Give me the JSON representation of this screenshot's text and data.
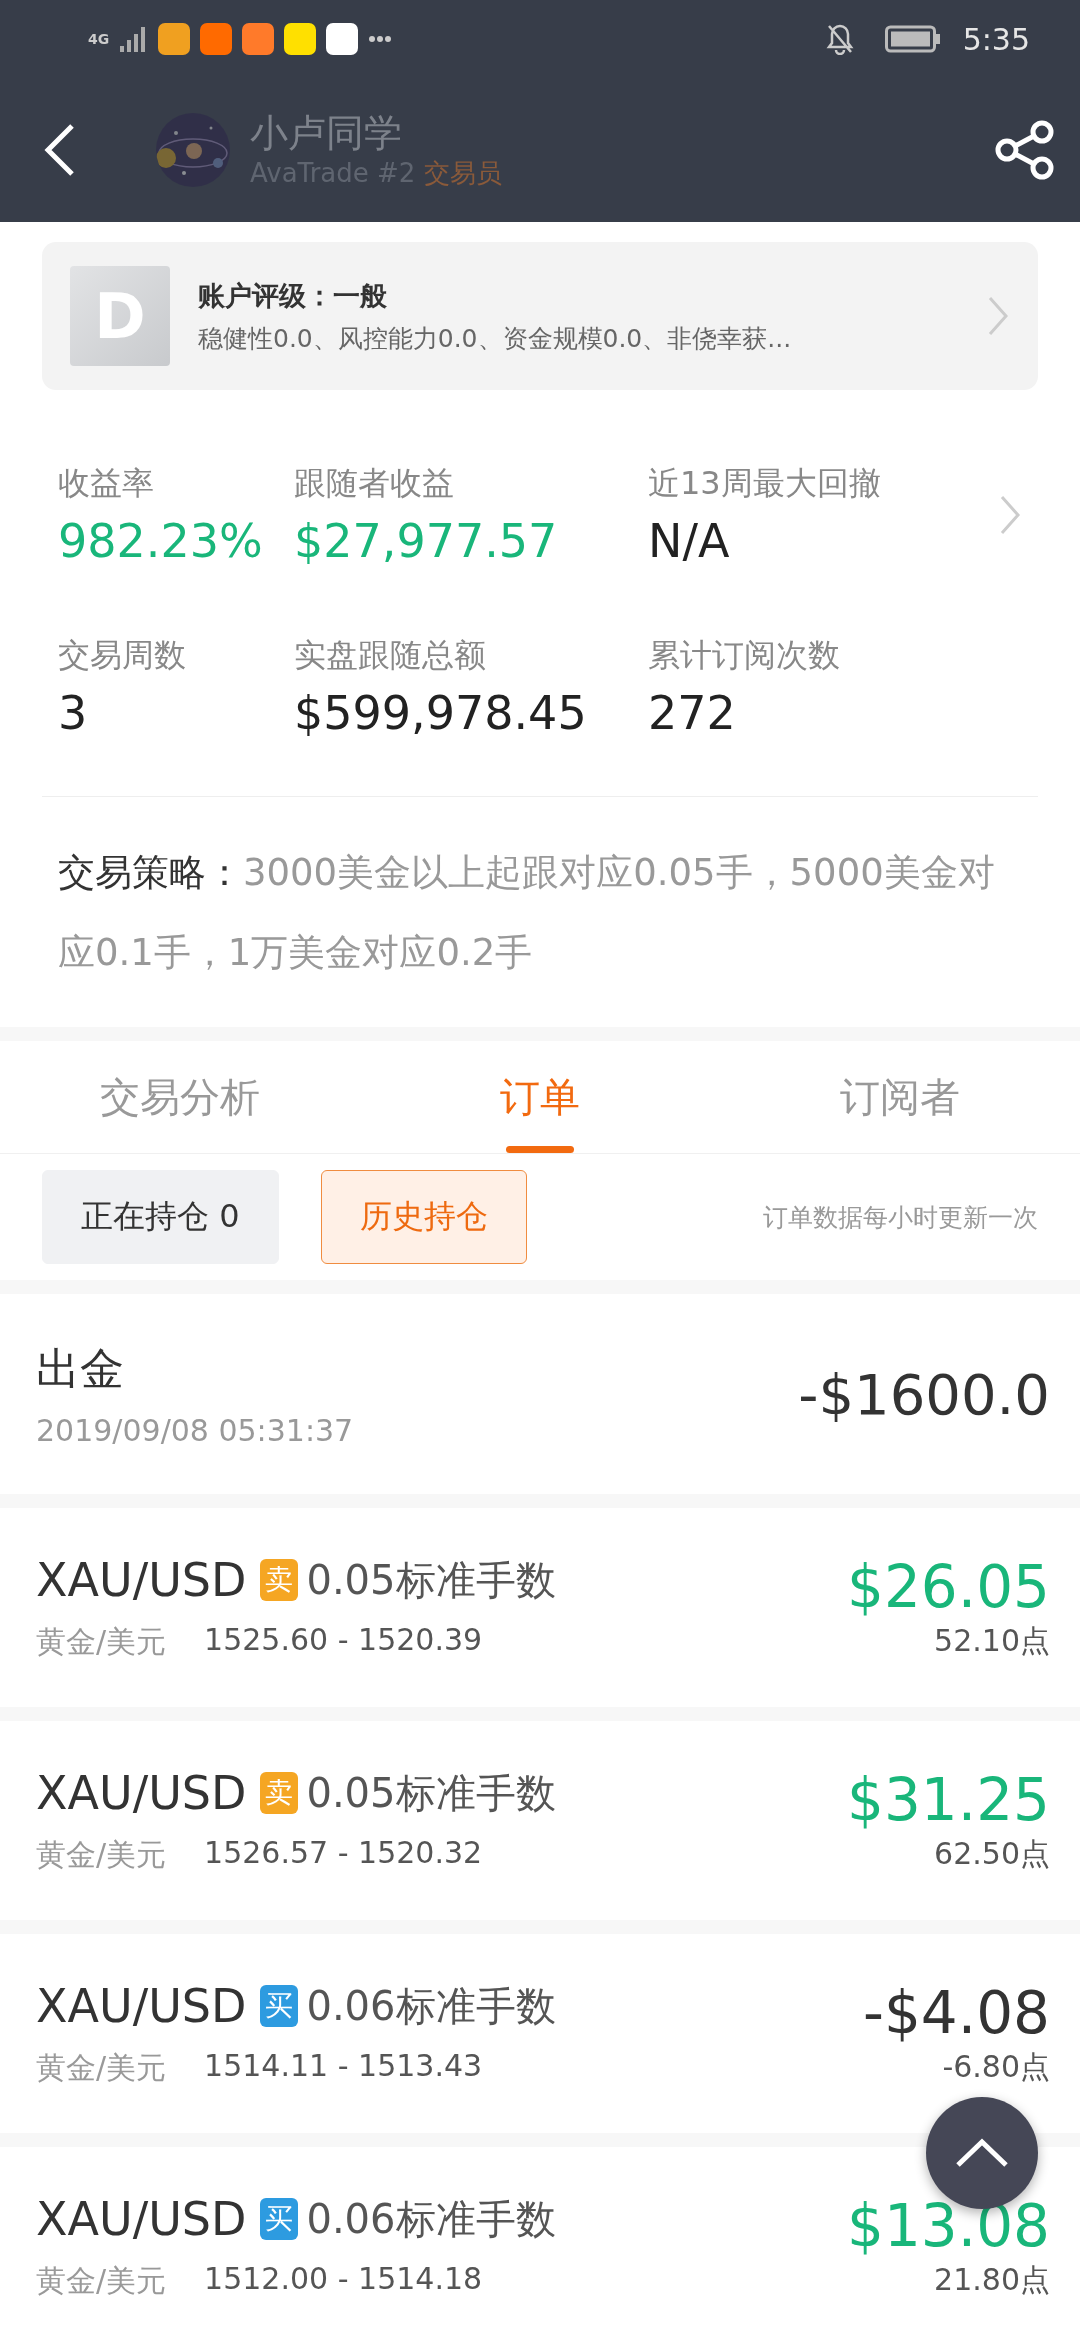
{
  "status_bar": {
    "network": "4G",
    "time": "5:35",
    "apps": [
      {
        "color": "#f0a020"
      },
      {
        "color": "#ff6a00"
      },
      {
        "color": "#ff7a2a"
      },
      {
        "color": "#ffe000"
      },
      {
        "color": "#ffffff"
      }
    ]
  },
  "header": {
    "name": "小卢同学",
    "broker": "AvaTrade #2",
    "role": "交易员"
  },
  "rating": {
    "grade": "D",
    "title": "账户评级：一般",
    "detail": "稳健性0.0、风控能力0.0、资金规模0.0、非侥幸获..."
  },
  "stats": [
    {
      "label": "收益率",
      "value": "982.23%",
      "highlight": true
    },
    {
      "label": "跟随者收益",
      "value": "$27,977.57",
      "highlight": true
    },
    {
      "label": "近13周最大回撤",
      "value": "N/A",
      "highlight": false
    },
    {
      "label": "交易周数",
      "value": "3",
      "highlight": false
    },
    {
      "label": "实盘跟随总额",
      "value": "$599,978.45",
      "highlight": false
    },
    {
      "label": "累计订阅次数",
      "value": "272",
      "highlight": false
    }
  ],
  "strategy": {
    "label": "交易策略：",
    "text": "3000美金以上起跟对应0.05手，5000美金对应0.1手，1万美金对应0.2手"
  },
  "tabs": [
    {
      "label": "交易分析",
      "selected": false
    },
    {
      "label": "订单",
      "selected": true
    },
    {
      "label": "订阅者",
      "selected": false
    }
  ],
  "filters": [
    {
      "label": "正在持仓 0",
      "selected": false
    },
    {
      "label": "历史持仓",
      "selected": true
    }
  ],
  "update_note": "订单数据每小时更新一次",
  "withdrawal": {
    "title": "出金",
    "time": "2019/09/08 05:31:37",
    "amount": "-$1600.0"
  },
  "orders": [
    {
      "symbol": "XAU/USD",
      "side": {
        "label": "卖",
        "color": "#f5a623"
      },
      "lots": "0.05标准手数",
      "name": "黄金/美元",
      "prices": "1525.60 - 1520.39",
      "profit": {
        "value": "$26.05",
        "color": "#19b67a"
      },
      "points": "52.10点"
    },
    {
      "symbol": "XAU/USD",
      "side": {
        "label": "卖",
        "color": "#f5a623"
      },
      "lots": "0.05标准手数",
      "name": "黄金/美元",
      "prices": "1526.57 - 1520.32",
      "profit": {
        "value": "$31.25",
        "color": "#19b67a"
      },
      "points": "62.50点"
    },
    {
      "symbol": "XAU/USD",
      "side": {
        "label": "买",
        "color": "#2d9be0"
      },
      "lots": "0.06标准手数",
      "name": "黄金/美元",
      "prices": "1514.11 - 1513.43",
      "profit": {
        "value": "-$4.08",
        "color": "#333333"
      },
      "points": "-6.80点"
    },
    {
      "symbol": "XAU/USD",
      "side": {
        "label": "买",
        "color": "#2d9be0"
      },
      "lots": "0.06标准手数",
      "name": "黄金/美元",
      "prices": "1512.00 - 1514.18",
      "profit": {
        "value": "$13.08",
        "color": "#19b67a"
      },
      "points": "21.80点"
    }
  ]
}
